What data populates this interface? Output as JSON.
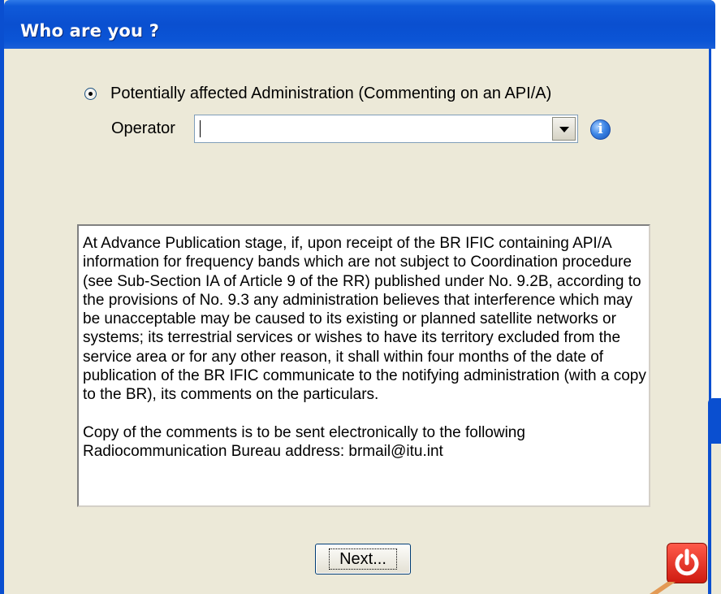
{
  "window": {
    "title": "Who are you ?"
  },
  "role": {
    "radio_label": "Potentially affected Administration (Commenting on an API/A)",
    "selected": true
  },
  "operator": {
    "label": "Operator",
    "value": ""
  },
  "info_text": {
    "paragraph1": "At Advance Publication stage, if, upon receipt of the BR IFIC containing API/A information for frequency bands which are not subject to Coordination procedure (see Sub-Section IA of Article 9 of the RR) published under No. 9.2B, according to the provisions of No. 9.3 any administration believes that interference which may be unacceptable may be caused to its existing or planned satellite networks or systems; its terrestrial services or wishes to have its territory excluded from the service area or for any other reason, it shall within four months of the date of publication of the BR IFIC communicate to the notifying administration (with a copy to the BR), its comments on the particulars.",
    "paragraph2": "Copy of the comments is to be sent electronically to the following Radiocommunication Bureau address: brmail@itu.int"
  },
  "buttons": {
    "next_label": "Next..."
  },
  "icons": {
    "info": "info-icon",
    "dropdown": "chevron-down-icon",
    "power": "power-icon"
  },
  "colors": {
    "titlebar": "#0a4fd0",
    "dialog_bg": "#ece9d8",
    "power_icon": "#d82a1e"
  }
}
